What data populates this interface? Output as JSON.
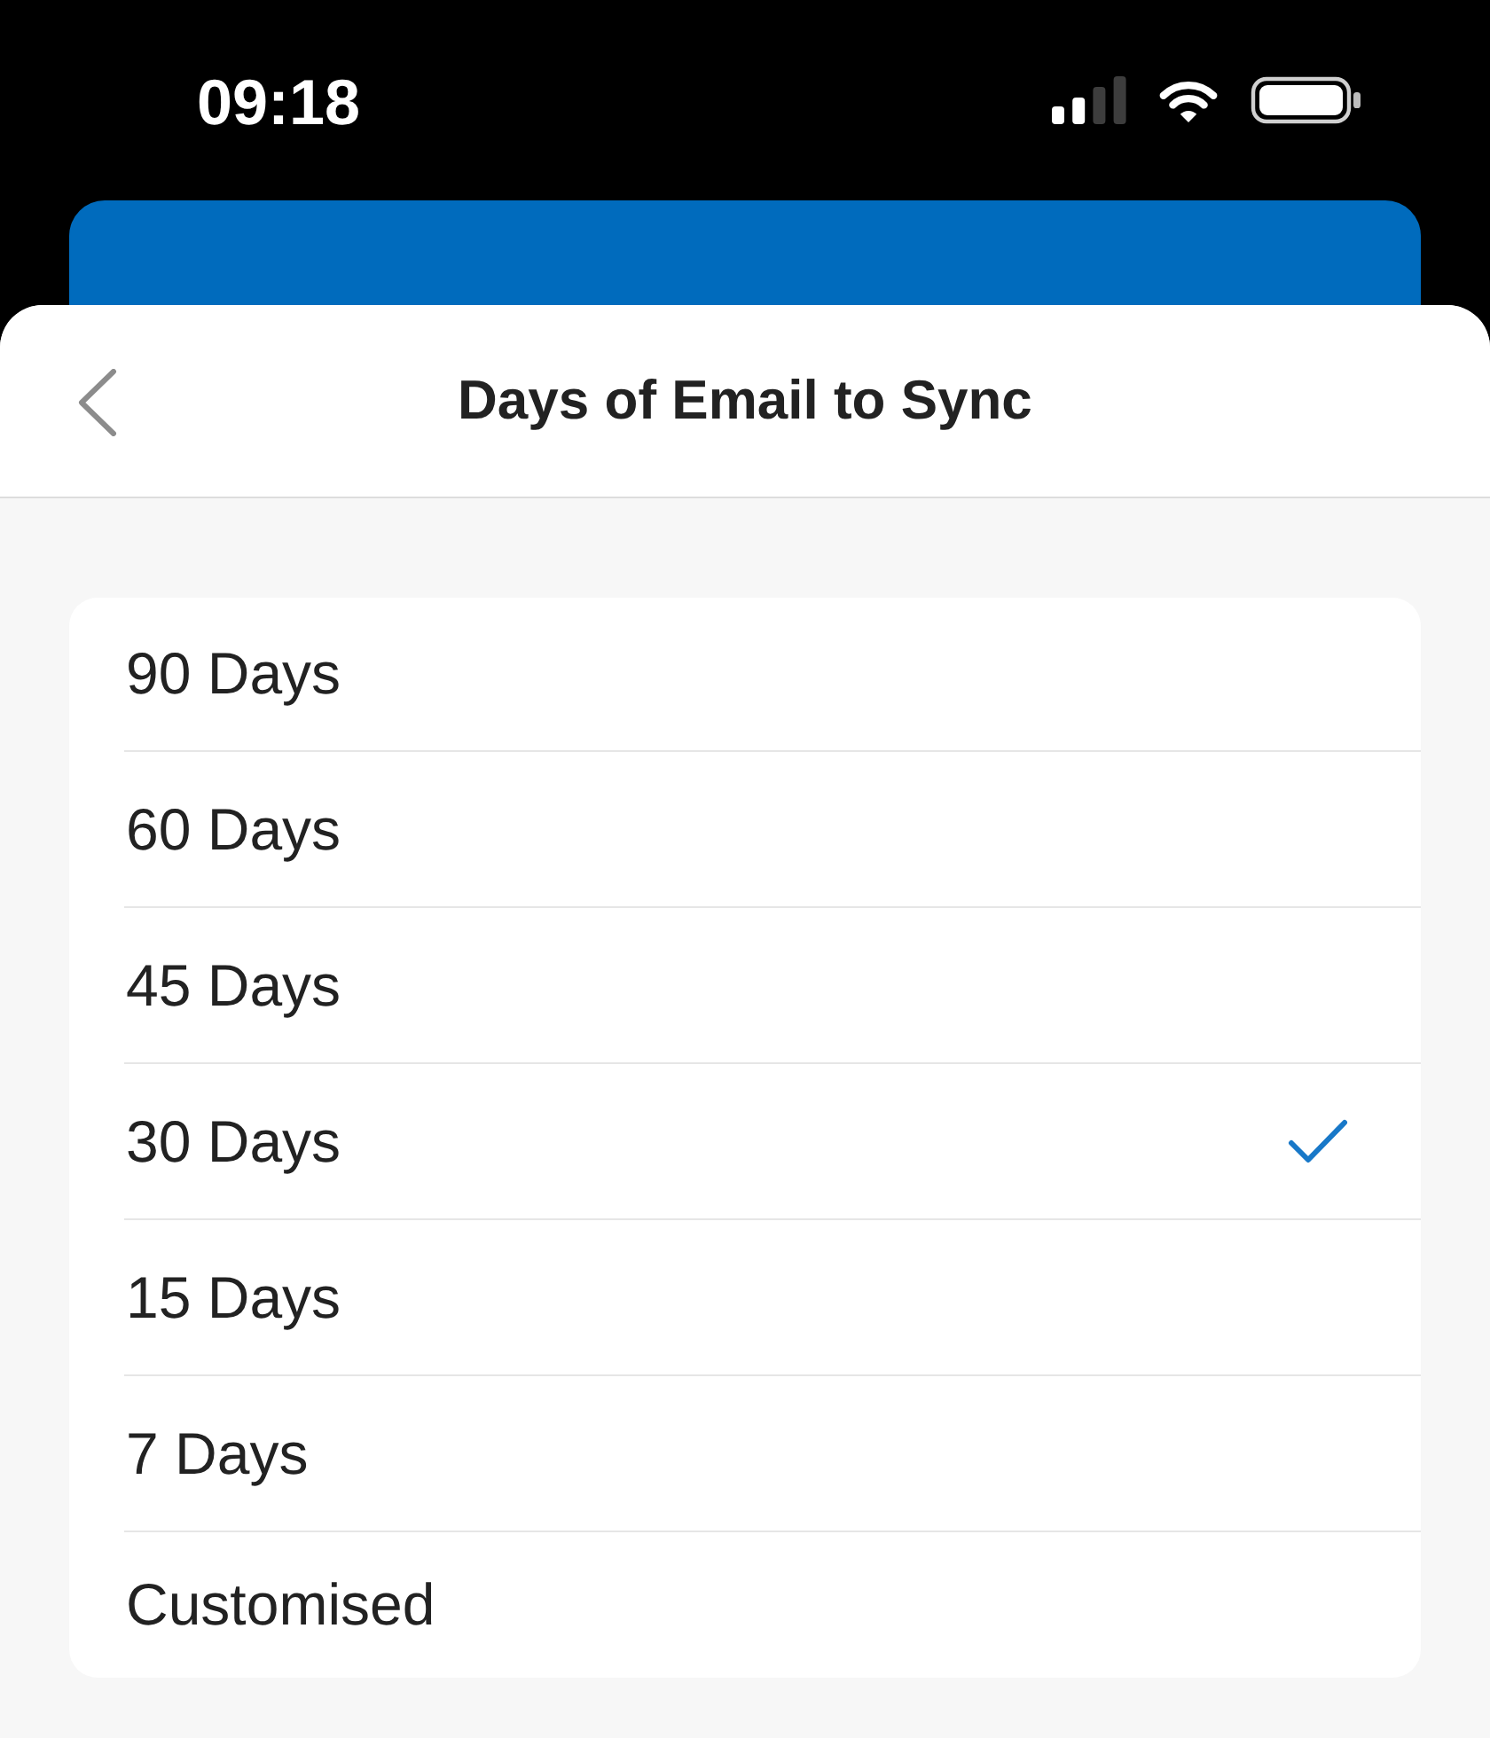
{
  "status_bar": {
    "time": "09:18"
  },
  "header": {
    "title": "Days of Email to Sync"
  },
  "options": [
    {
      "label": "90 Days",
      "selected": false
    },
    {
      "label": "60 Days",
      "selected": false
    },
    {
      "label": "45 Days",
      "selected": false
    },
    {
      "label": "30 Days",
      "selected": true
    },
    {
      "label": "15 Days",
      "selected": false
    },
    {
      "label": "7 Days",
      "selected": false
    },
    {
      "label": "Customised",
      "selected": false
    }
  ]
}
